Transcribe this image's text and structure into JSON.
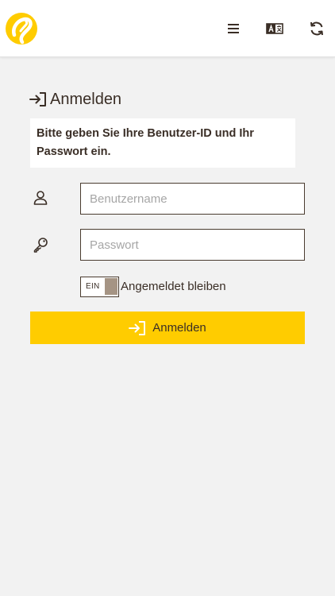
{
  "header": {
    "logo_icon": "yellow-logo-icon",
    "menu_icon": "hamburger-menu-icon",
    "language_icon": "language-switch-icon",
    "refresh_icon": "refresh-icon"
  },
  "login": {
    "title": "Anmelden",
    "title_icon": "sign-in-icon",
    "notice": "Bitte geben Sie Ihre Benutzer-ID und Ihr Passwort ein.",
    "username_placeholder": "Benutzername",
    "username_value": "",
    "username_icon": "user-icon",
    "password_placeholder": "Passwort",
    "password_value": "",
    "password_icon": "key-icon",
    "remember_toggle_label": "EIN",
    "remember_label": "Angemeldet bleiben",
    "submit_label": "Anmelden",
    "submit_icon": "sign-in-icon"
  },
  "colors": {
    "accent": "#ffcc00",
    "text": "#3a2e26",
    "background": "#f2f2f2",
    "toggle_knob": "#a59484"
  }
}
